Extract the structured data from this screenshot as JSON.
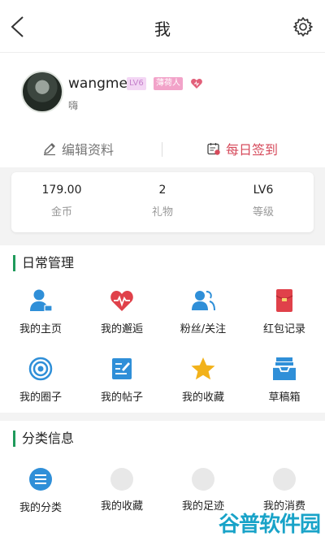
{
  "header": {
    "title": "我"
  },
  "profile": {
    "username": "wangmei",
    "level_badge": "LV6",
    "title_badge": "薄荷人",
    "signature": "嗨",
    "edit_label": "编辑资料",
    "checkin_label": "每日签到"
  },
  "stats": [
    {
      "value": "179.00",
      "label": "金币"
    },
    {
      "value": "2",
      "label": "礼物"
    },
    {
      "value": "LV6",
      "label": "等级"
    }
  ],
  "daily": {
    "title": "日常管理",
    "items": [
      {
        "label": "我的主页",
        "icon": "person-card-icon"
      },
      {
        "label": "我的邂逅",
        "icon": "heartbeat-icon"
      },
      {
        "label": "粉丝/关注",
        "icon": "users-icon"
      },
      {
        "label": "红包记录",
        "icon": "red-envelope-icon"
      },
      {
        "label": "我的圈子",
        "icon": "target-icon"
      },
      {
        "label": "我的帖子",
        "icon": "edit-note-icon"
      },
      {
        "label": "我的收藏",
        "icon": "star-icon"
      },
      {
        "label": "草稿箱",
        "icon": "inbox-icon"
      }
    ]
  },
  "category": {
    "title": "分类信息",
    "items": [
      {
        "label": "我的分类",
        "icon": "list-icon"
      },
      {
        "label": "我的收藏",
        "icon": "placeholder-icon"
      },
      {
        "label": "我的足迹",
        "icon": "placeholder-icon"
      },
      {
        "label": "我的消费",
        "icon": "placeholder-icon"
      }
    ]
  },
  "watermark": "谷普软件园",
  "colors": {
    "accent_green": "#1f9a5b",
    "checkin_red": "#d64b5c",
    "icon_blue": "#2f8fd8",
    "icon_red": "#e0414a",
    "icon_gold": "#f2b21b"
  }
}
